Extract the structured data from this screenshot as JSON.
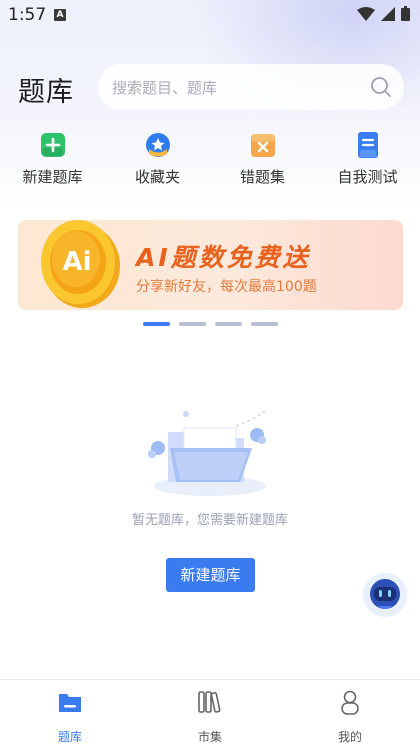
{
  "status_bar": {
    "time": "1:57",
    "notification_glyph": "A"
  },
  "header": {
    "title": "题库",
    "search_placeholder": "搜索题目、题库"
  },
  "quick_actions": [
    {
      "label": "新建题库",
      "icon": "add-square-icon",
      "color": "#2fc26b"
    },
    {
      "label": "收藏夹",
      "icon": "star-folder-icon",
      "color": "#2f7cf0"
    },
    {
      "label": "错题集",
      "icon": "wrong-book-icon",
      "color": "#f29a3c"
    },
    {
      "label": "自我测试",
      "icon": "test-sheet-icon",
      "color": "#3b7ef2"
    }
  ],
  "banner": {
    "coin_text": "Ai",
    "title": "AI题数免费送",
    "subtitle": "分享新好友，每次最高100题"
  },
  "carousel": {
    "total": 4,
    "active_index": 0
  },
  "empty_state": {
    "message": "暂无题库，您需要新建题库",
    "button_label": "新建题库"
  },
  "bottom_nav": [
    {
      "label": "题库",
      "icon": "folder-icon",
      "active": true
    },
    {
      "label": "市集",
      "icon": "books-icon",
      "active": false
    },
    {
      "label": "我的",
      "icon": "person-icon",
      "active": false
    }
  ],
  "colors": {
    "accent": "#3a7bf0",
    "banner_orange": "#e8611d"
  }
}
